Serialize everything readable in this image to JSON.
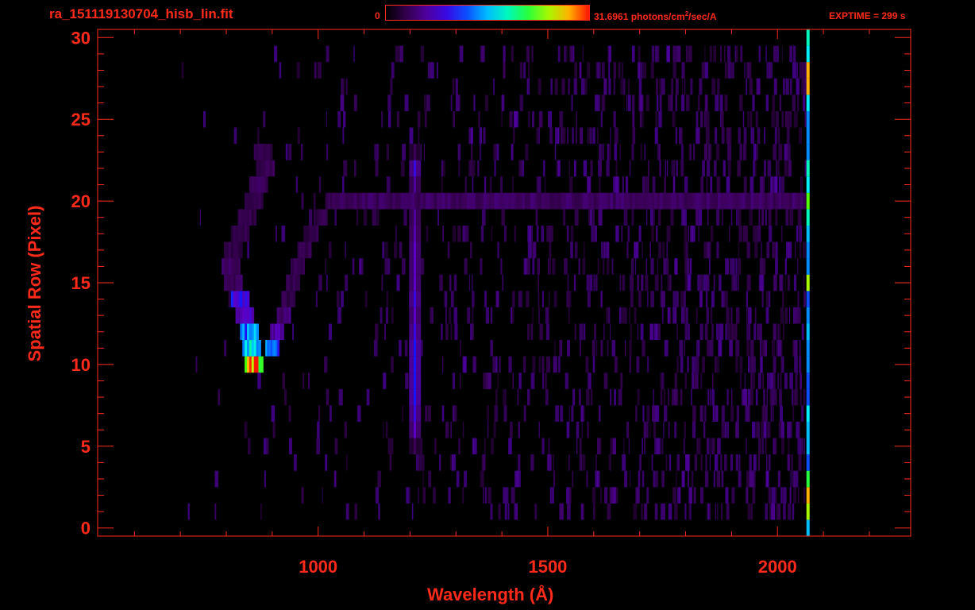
{
  "header": {
    "filename": "ra_151119130704_hisb_lin.fit",
    "colorbar_min": "0",
    "colorbar_max_prefix": "31.6961 photons/cm",
    "colorbar_max_sup": "2",
    "colorbar_max_suffix": "/sec/A",
    "exptime": "EXPTIME = 299 s"
  },
  "colors": {
    "axis": "#ff2a1a",
    "background": "#000000"
  },
  "chart_data": {
    "type": "heatmap",
    "title": "ra_151119130704_hisb_lin.fit",
    "xlabel": "Wavelength (Å)",
    "ylabel": "Spatial Row (Pixel)",
    "xlim": [
      520,
      2290
    ],
    "ylim": [
      -0.5,
      30.5
    ],
    "xticks": [
      1000,
      1500,
      2000
    ],
    "yticks": [
      0,
      5,
      10,
      15,
      20,
      25,
      30
    ],
    "colorscale": {
      "min": 0,
      "max": 31.6961,
      "unit": "photons/cm²/sec/A",
      "palette": "rainbow"
    },
    "features": [
      {
        "name": "arc",
        "rows": [
          [
            10,
            860,
            0.9
          ],
          [
            11,
            855,
            0.55
          ],
          [
            12,
            850,
            0.45
          ],
          [
            13,
            840,
            0.25
          ],
          [
            14,
            830,
            0.3
          ],
          [
            15,
            815,
            0.12
          ],
          [
            16,
            810,
            0.12
          ],
          [
            17,
            815,
            0.1
          ],
          [
            18,
            830,
            0.1
          ],
          [
            19,
            845,
            0.1
          ],
          [
            20,
            860,
            0.1
          ],
          [
            21,
            870,
            0.12
          ],
          [
            22,
            885,
            0.1
          ],
          [
            23,
            880,
            0.1
          ]
        ]
      },
      {
        "name": "arc-tail",
        "rows": [
          [
            11,
            900,
            0.4
          ],
          [
            12,
            910,
            0.2
          ],
          [
            13,
            925,
            0.15
          ],
          [
            14,
            935,
            0.1
          ],
          [
            15,
            945,
            0.1
          ],
          [
            16,
            955,
            0.1
          ],
          [
            17,
            970,
            0.1
          ],
          [
            18,
            985,
            0.1
          ],
          [
            19,
            1005,
            0.1
          ],
          [
            20,
            1030,
            0.1
          ]
        ]
      },
      {
        "name": "vertical-line",
        "x": 1210,
        "rows": [
          [
            5,
            0.12
          ],
          [
            6,
            0.25
          ],
          [
            7,
            0.3
          ],
          [
            8,
            0.35
          ],
          [
            9,
            0.35
          ],
          [
            10,
            0.35
          ],
          [
            11,
            0.35
          ],
          [
            12,
            0.3
          ],
          [
            13,
            0.25
          ],
          [
            14,
            0.3
          ],
          [
            15,
            0.25
          ],
          [
            16,
            0.25
          ],
          [
            17,
            0.25
          ],
          [
            18,
            0.22
          ],
          [
            19,
            0.2
          ],
          [
            20,
            0.2
          ],
          [
            21,
            0.2
          ],
          [
            22,
            0.3
          ],
          [
            23,
            0.12
          ]
        ]
      },
      {
        "name": "horizontal-band",
        "row": 20,
        "x_from": 1030,
        "x_to": 2060,
        "level": 0.12
      },
      {
        "name": "edge-column",
        "x": 2063,
        "rows": [
          [
            0,
            0.5
          ],
          [
            1,
            0.8
          ],
          [
            2,
            0.9
          ],
          [
            3,
            0.7
          ],
          [
            4,
            0.4
          ],
          [
            5,
            0.5
          ],
          [
            6,
            0.5
          ],
          [
            7,
            0.55
          ],
          [
            8,
            0.4
          ],
          [
            9,
            0.4
          ],
          [
            10,
            0.45
          ],
          [
            11,
            0.45
          ],
          [
            12,
            0.5
          ],
          [
            13,
            0.45
          ],
          [
            14,
            0.4
          ],
          [
            15,
            0.8
          ],
          [
            16,
            0.45
          ],
          [
            17,
            0.45
          ],
          [
            18,
            0.5
          ],
          [
            19,
            0.6
          ],
          [
            20,
            0.75
          ],
          [
            21,
            0.55
          ],
          [
            22,
            0.6
          ],
          [
            23,
            0.45
          ],
          [
            24,
            0.45
          ],
          [
            25,
            0.45
          ],
          [
            26,
            0.55
          ],
          [
            27,
            0.9
          ],
          [
            28,
            0.9
          ],
          [
            29,
            0.55
          ],
          [
            30,
            0.6
          ]
        ]
      }
    ]
  }
}
